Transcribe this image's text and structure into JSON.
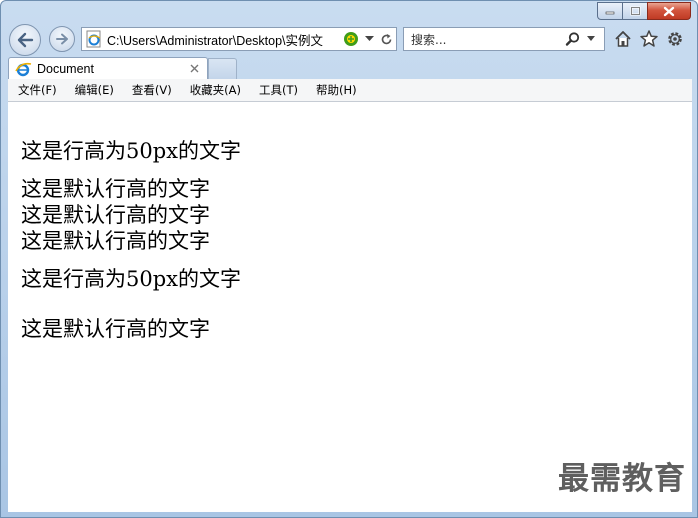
{
  "browser": {
    "address_url": "C:\\Users\\Administrator\\Desktop\\实例文",
    "search_placeholder": "搜索...",
    "tab_title": "Document"
  },
  "menu": {
    "items": [
      "文件(F)",
      "编辑(E)",
      "查看(V)",
      "收藏夹(A)",
      "工具(T)",
      "帮助(H)"
    ]
  },
  "content": {
    "lines": [
      "这是行高为50px的文字",
      "这是默认行高的文字",
      "这是默认行高的文字",
      "这是默认行高的文字",
      "这是行高为50px的文字",
      "这是默认行高的文字"
    ]
  },
  "watermark": "最需教育",
  "icons": {
    "back": "back-arrow-icon",
    "forward": "forward-arrow-icon",
    "ie_page": "ie-page-icon",
    "compat": "compatibility-view-icon",
    "refresh": "refresh-icon",
    "search": "magnifier-icon",
    "home": "home-icon",
    "favorites": "star-icon",
    "tools": "gear-icon"
  }
}
